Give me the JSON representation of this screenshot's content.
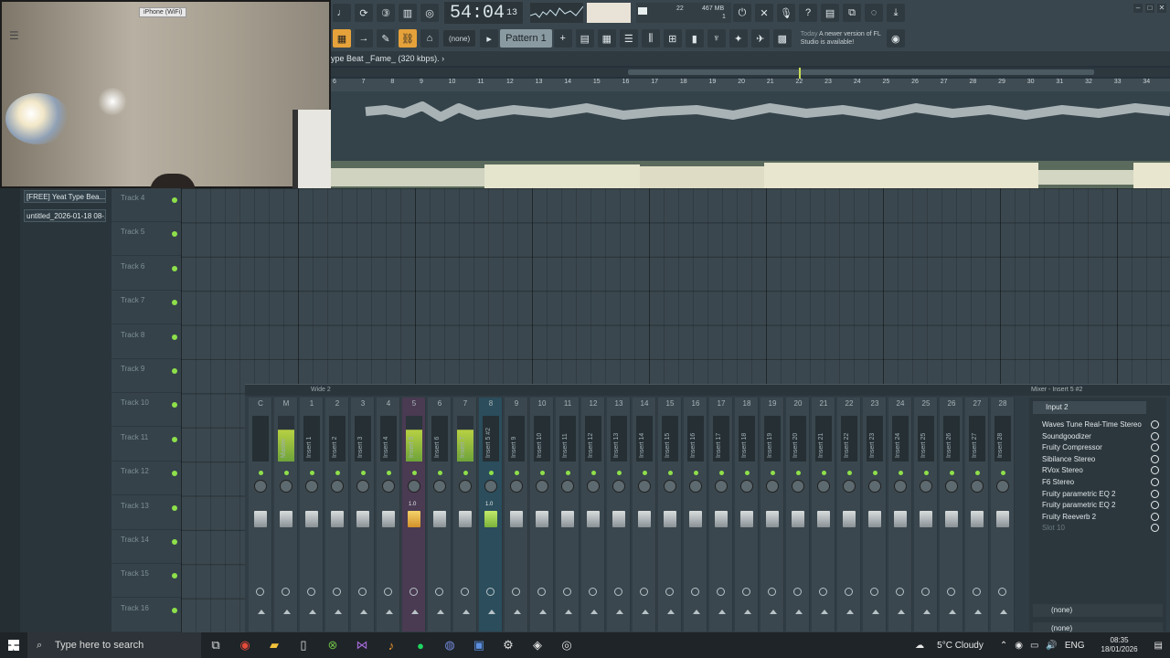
{
  "webcam": {
    "source_label": "iPhone (WiFi)"
  },
  "toolbar": {
    "time": "54:04",
    "time_sub": "13",
    "mem": "467 MB",
    "mem_num": "22",
    "mem_sub": "1",
    "pattern_selector": "(none)",
    "pattern": "Pattern 1",
    "news_prefix": "Today",
    "news_text": "A newer version of FL Studio is available!"
  },
  "song": {
    "title": "ype Beat _Fame_ (320 kbps)."
  },
  "ruler": [
    "6",
    "7",
    "8",
    "9",
    "10",
    "11",
    "12",
    "13",
    "14",
    "15",
    "16",
    "17",
    "18",
    "19",
    "20",
    "21",
    "22",
    "23",
    "24",
    "25",
    "26",
    "27",
    "28",
    "29",
    "30",
    "31",
    "32",
    "33",
    "34"
  ],
  "browser": {
    "items": [
      "[FREE] Yeat Type Bea...",
      "untitled_2026-01-18 08-..."
    ]
  },
  "tracks": [
    "Track 4",
    "Track 5",
    "Track 6",
    "Track 7",
    "Track 8",
    "Track 9",
    "Track 10",
    "Track 11",
    "Track 12",
    "Track 13",
    "Track 14",
    "Track 15",
    "Track 16"
  ],
  "mixer": {
    "title": "Wide 2",
    "panel_title": "Mixer - Insert 5 #2",
    "strips": [
      {
        "num": "C",
        "name": ""
      },
      {
        "num": "M",
        "name": "Master"
      },
      {
        "num": "1",
        "name": "Insert 1"
      },
      {
        "num": "2",
        "name": "Insert 2"
      },
      {
        "num": "3",
        "name": "Insert 3"
      },
      {
        "num": "4",
        "name": "Insert 4"
      },
      {
        "num": "5",
        "name": "Insert 5"
      },
      {
        "num": "6",
        "name": "Insert 6"
      },
      {
        "num": "7",
        "name": "Insert 7"
      },
      {
        "num": "8",
        "name": "Insert 5 #2"
      },
      {
        "num": "9",
        "name": "Insert 9"
      },
      {
        "num": "10",
        "name": "Insert 10"
      },
      {
        "num": "11",
        "name": "Insert 11"
      },
      {
        "num": "12",
        "name": "Insert 12"
      },
      {
        "num": "13",
        "name": "Insert 13"
      },
      {
        "num": "14",
        "name": "Insert 14"
      },
      {
        "num": "15",
        "name": "Insert 15"
      },
      {
        "num": "16",
        "name": "Insert 16"
      },
      {
        "num": "17",
        "name": "Insert 17"
      },
      {
        "num": "18",
        "name": "Insert 18"
      },
      {
        "num": "19",
        "name": "Insert 19"
      },
      {
        "num": "20",
        "name": "Insert 20"
      },
      {
        "num": "21",
        "name": "Insert 21"
      },
      {
        "num": "22",
        "name": "Insert 22"
      },
      {
        "num": "23",
        "name": "Insert 23"
      },
      {
        "num": "24",
        "name": "Insert 24"
      },
      {
        "num": "25",
        "name": "Insert 25"
      },
      {
        "num": "26",
        "name": "Insert 26"
      },
      {
        "num": "27",
        "name": "Insert 27"
      },
      {
        "num": "28",
        "name": "Insert 28"
      }
    ],
    "fader_value": "1.0",
    "fx_input": "Input 2",
    "fx_slots": [
      "Waves Tune Real-Time Stereo",
      "Soundgoodizer",
      "Fruity Compressor",
      "Sibilance Stereo",
      "RVox Stereo",
      "F6 Stereo",
      "Fruity parametric EQ 2",
      "Fruity parametric EQ 2",
      "Fruity Reeverb 2",
      "Slot 10"
    ],
    "fx_out1": "(none)",
    "fx_out2": "(none)"
  },
  "taskbar": {
    "search_placeholder": "Type here to search",
    "weather": "5°C  Cloudy",
    "time": "08:35",
    "date": "18/01/2026"
  },
  "colors": {
    "accent": "#e6a23a",
    "meter_green": "#8ee04a",
    "selected_strip": "#2b4d5c"
  }
}
